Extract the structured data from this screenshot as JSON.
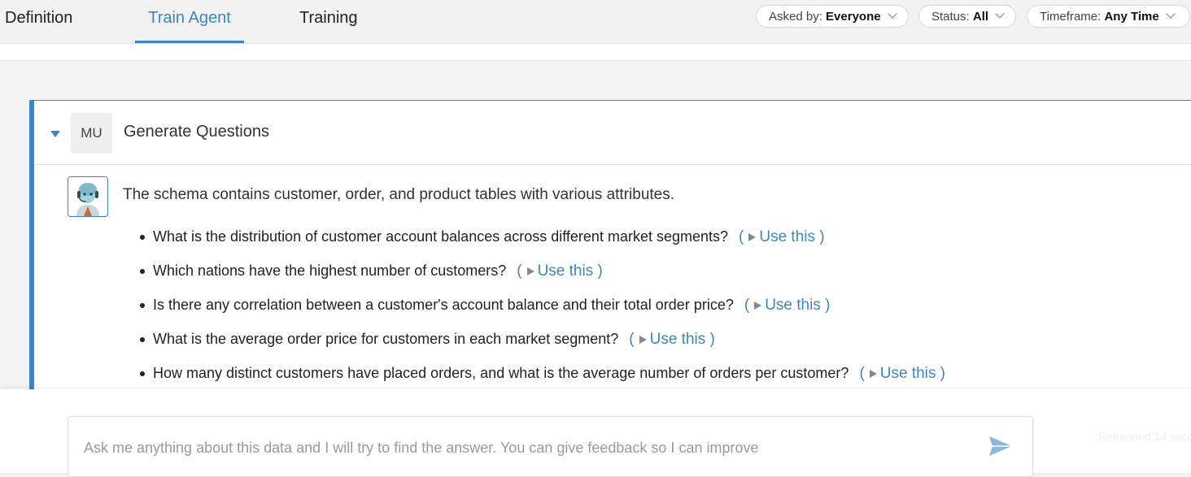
{
  "tabs": [
    {
      "label": "Definition",
      "active": false
    },
    {
      "label": "Train Agent",
      "active": true
    },
    {
      "label": "Training",
      "active": false
    }
  ],
  "filters": [
    {
      "label": "Asked by:",
      "value": "Everyone"
    },
    {
      "label": "Status:",
      "value": "All"
    },
    {
      "label": "Timeframe:",
      "value": "Any Time"
    }
  ],
  "card": {
    "user_initials": "MU",
    "title": "Generate Questions",
    "summary": "The schema contains customer, order, and product tables with various attributes.",
    "use_label": "Use this",
    "questions": [
      "What is the distribution of customer account balances across different market segments?",
      "Which nations have the highest number of customers?",
      "Is there any correlation between a customer's account balance and their total order price?",
      "What is the average order price for customers in each market segment?",
      "How many distinct customers have placed orders, and what is the average number of orders per customer?"
    ]
  },
  "ask": {
    "placeholder": "Ask me anything about this data and I will try to find the answer. You can give feedback so I can improve"
  },
  "status_text": "Refreshed 14 seco",
  "colors": {
    "accent": "#3b86c8",
    "bot_skin": "#9fd3dd",
    "bot_accent": "#d9632b"
  }
}
